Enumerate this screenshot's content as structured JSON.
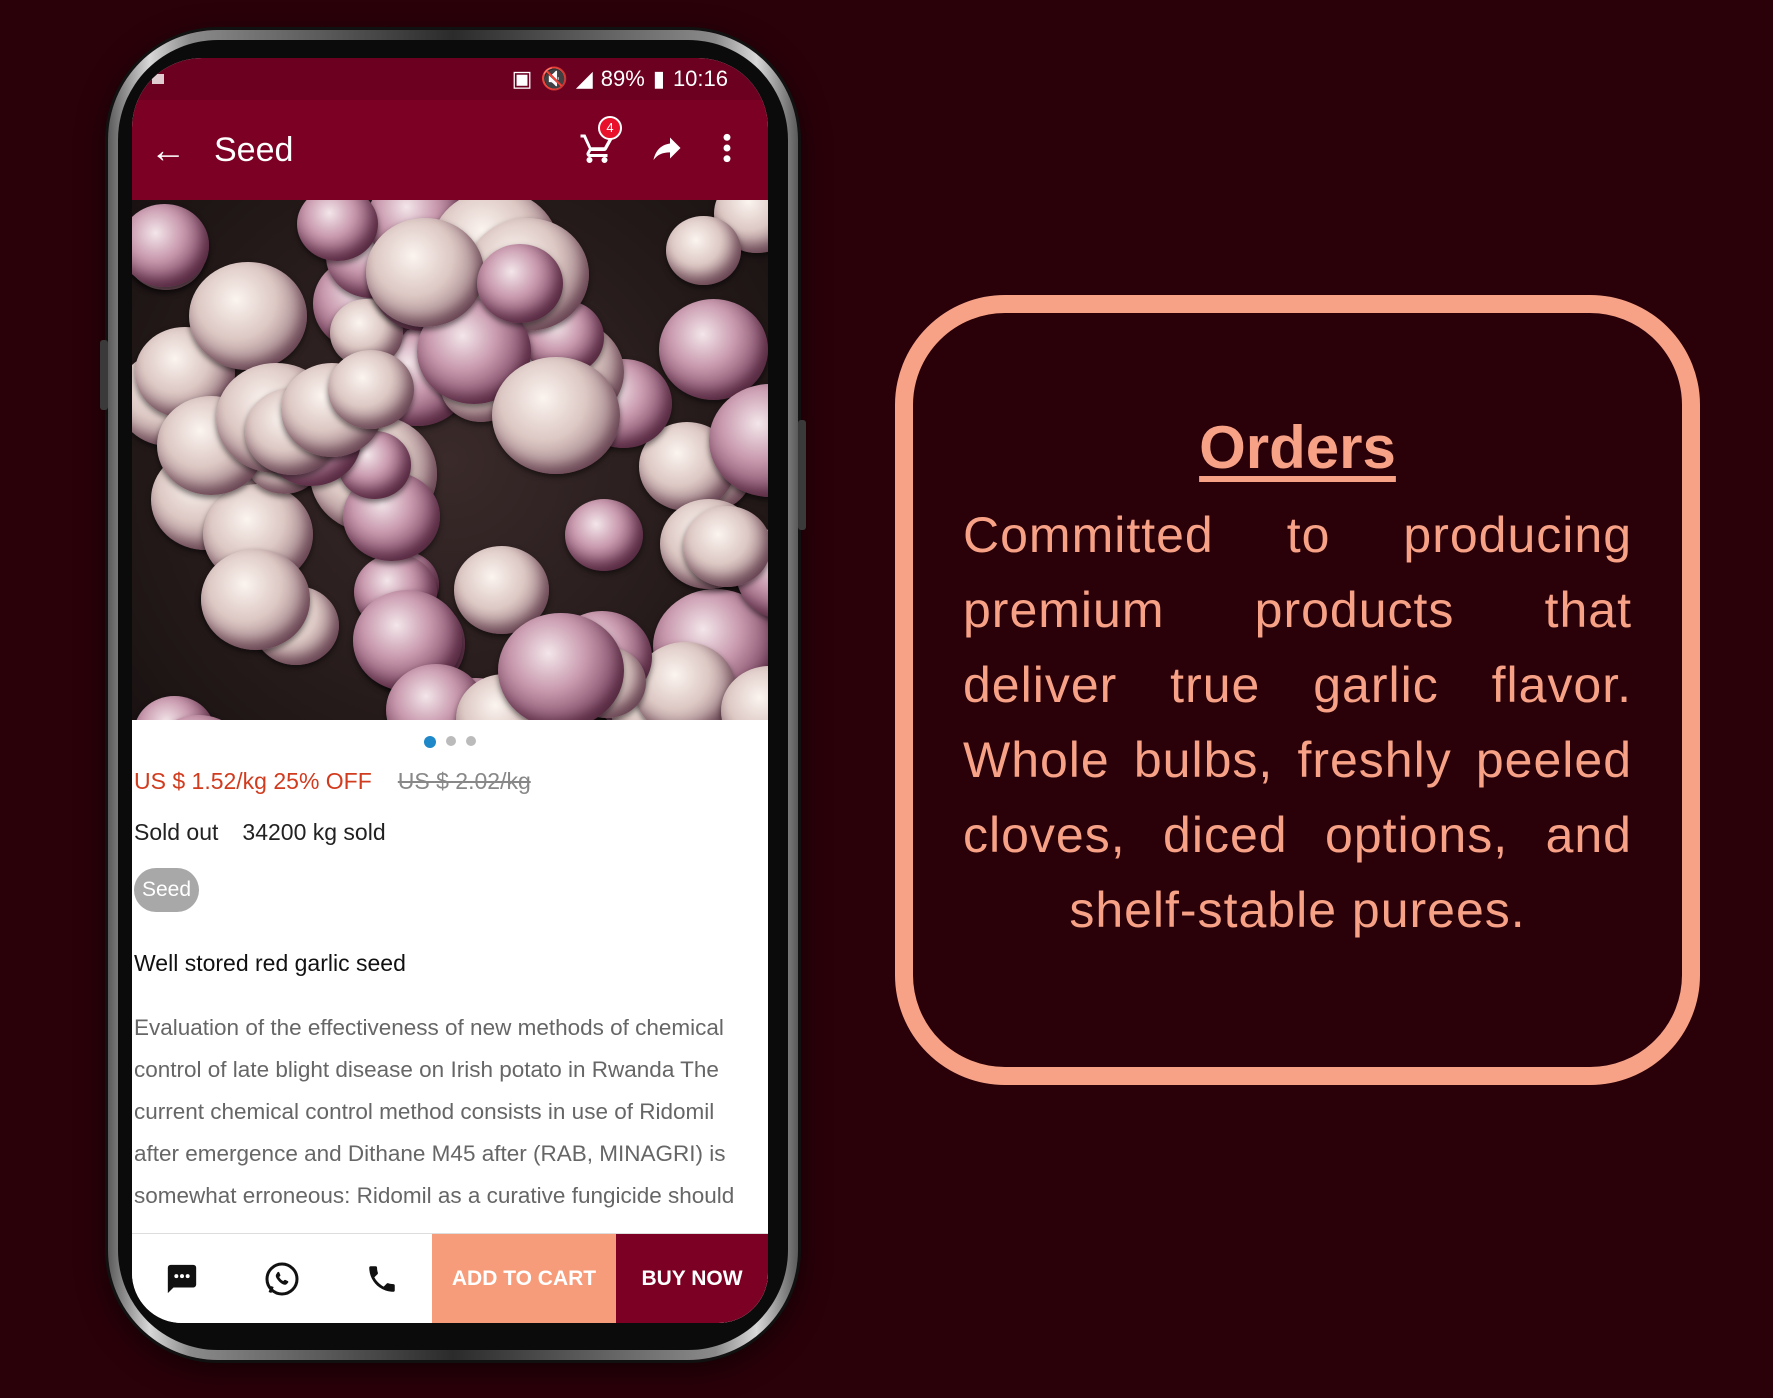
{
  "status_bar": {
    "battery": "89%",
    "time": "10:16"
  },
  "app_bar": {
    "back_icon": "arrow-left-icon",
    "title": "Seed",
    "cart_count": "4",
    "cart_icon": "cart-icon",
    "share_icon": "share-icon",
    "more_icon": "more-vert-icon"
  },
  "product": {
    "image_carousel": {
      "total": 3,
      "active": 1
    },
    "price_new": "US $ 1.52/kg 25% OFF",
    "price_old": "US $ 2.02/kg",
    "stock_status": "Sold out",
    "sold_count": "34200 kg sold",
    "tag": "Seed",
    "name": "Well stored red garlic seed",
    "description": "Evaluation of the effectiveness of new methods of chemical control of late blight disease on Irish potato in Rwanda  The current chemical control method consists in use of Ridomil after emergence and Dithane M45 after (RAB, MINAGRI) is somewhat erroneous: Ridomil as a curative fungicide should"
  },
  "bottom_bar": {
    "chat_icon": "chat-icon",
    "whatsapp_icon": "whatsapp-icon",
    "phone_icon": "phone-icon",
    "add_to_cart": "ADD TO CART",
    "buy_now": "BUY NOW"
  },
  "card": {
    "title": "Orders",
    "text": "Committed to producing premium products that deliver true garlic flavor. Whole bulbs, freshly peeled cloves, diced options, and shelf-stable purees."
  },
  "colors": {
    "background": "#2a0009",
    "primary": "#7b0023",
    "accent": "#f7a286",
    "price_red": "#d13b1e"
  }
}
